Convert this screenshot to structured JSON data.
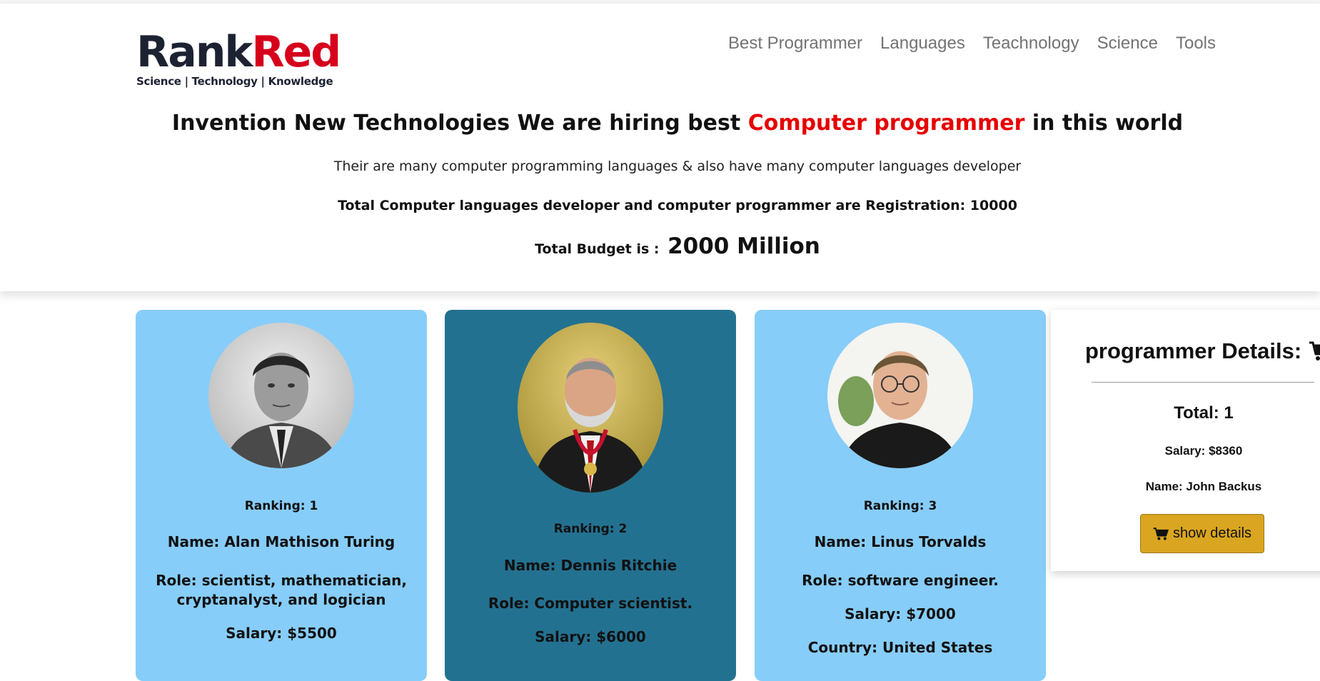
{
  "brand": {
    "logo_part1": "Rank",
    "logo_part2": "Red",
    "tagline": "Science | Technology | Knowledge"
  },
  "nav": {
    "items": [
      "Best Programmer",
      "Languages",
      "Teachnology",
      "Science",
      "Tools"
    ]
  },
  "hero": {
    "headline_prefix": "Invention New Technologies We are hiring best",
    "headline_accent": "Computer programmer",
    "headline_suffix": "in this world",
    "subtext": "Their are many computer programming languages & also have many computer languages developer",
    "registration": "Total Computer languages developer and computer programmer are Registration: 10000",
    "budget_label": "Total Budget is :",
    "budget_value": "2000 Million"
  },
  "programmers": [
    {
      "ranking": "Ranking: 1",
      "name": "Name: Alan Mathison Turing",
      "role": "Role: scientist, mathematician, cryptanalyst, and logician",
      "salary": "Salary: $5500",
      "theme": "light",
      "portrait": "alan-turing-portrait"
    },
    {
      "ranking": "Ranking: 2",
      "name": "Name: Dennis Ritchie",
      "role": "Role: Computer scientist.",
      "salary": "Salary: $6000",
      "theme": "dark",
      "portrait": "dennis-ritchie-portrait"
    },
    {
      "ranking": "Ranking: 3",
      "name": "Name: Linus Torvalds",
      "role": "Role: software engineer.",
      "salary": "Salary: $7000",
      "country": "Country: United States",
      "theme": "light",
      "portrait": "linus-torvalds-portrait"
    }
  ],
  "summary": {
    "title": "programmer Details:",
    "title_icon": "shopping-cart-icon",
    "total": "Total: 1",
    "salary": "Salary: $8360",
    "name": "Name: John Backus",
    "button_label": "show details",
    "button_icon": "shopping-cart-icon"
  },
  "colors": {
    "accent_red": "#e60000",
    "card_light": "#87cdf9",
    "card_dark": "#237190",
    "button_gold": "#daa520"
  }
}
